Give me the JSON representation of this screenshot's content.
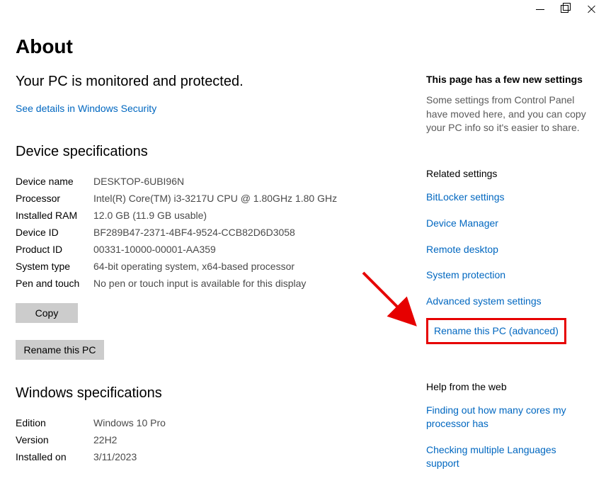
{
  "page": {
    "title": "About",
    "subhead": "Your PC is monitored and protected.",
    "security_link": "See details in Windows Security"
  },
  "device_spec": {
    "title": "Device specifications",
    "rows": [
      {
        "label": "Device name",
        "value": "DESKTOP-6UBI96N"
      },
      {
        "label": "Processor",
        "value": "Intel(R) Core(TM) i3-3217U CPU @ 1.80GHz   1.80 GHz"
      },
      {
        "label": "Installed RAM",
        "value": "12.0 GB (11.9 GB usable)"
      },
      {
        "label": "Device ID",
        "value": "BF289B47-2371-4BF4-9524-CCB82D6D3058"
      },
      {
        "label": "Product ID",
        "value": "00331-10000-00001-AA359"
      },
      {
        "label": "System type",
        "value": "64-bit operating system, x64-based processor"
      },
      {
        "label": "Pen and touch",
        "value": "No pen or touch input is available for this display"
      }
    ],
    "copy_btn": "Copy",
    "rename_btn": "Rename this PC"
  },
  "win_spec": {
    "title": "Windows specifications",
    "rows": [
      {
        "label": "Edition",
        "value": "Windows 10 Pro"
      },
      {
        "label": "Version",
        "value": "22H2"
      },
      {
        "label": "Installed on",
        "value": "3/11/2023"
      }
    ]
  },
  "side": {
    "new_title": "This page has a few new settings",
    "new_para": "Some settings from Control Panel have moved here, and you can copy your PC info so it's easier to share.",
    "related_title": "Related settings",
    "related_links": [
      "BitLocker settings",
      "Device Manager",
      "Remote desktop",
      "System protection",
      "Advanced system settings"
    ],
    "highlighted_link": "Rename this PC (advanced)",
    "help_title": "Help from the web",
    "help_links": [
      "Finding out how many cores my processor has",
      "Checking multiple Languages support"
    ]
  }
}
